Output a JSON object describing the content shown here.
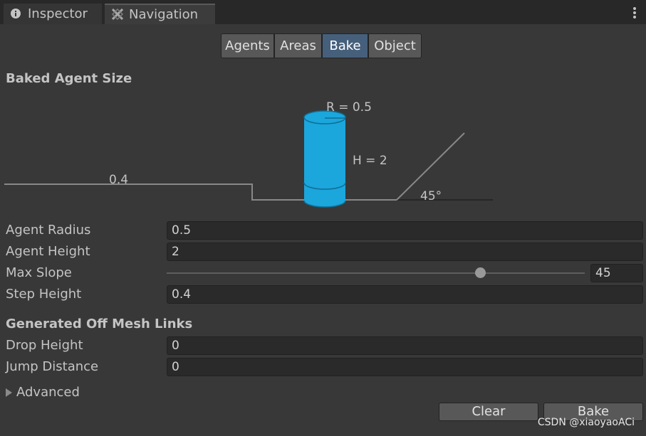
{
  "tabs": [
    {
      "label": "Inspector",
      "icon": "info-icon",
      "active": false
    },
    {
      "label": "Navigation",
      "icon": "navigation-icon",
      "active": true
    }
  ],
  "menu_icon": "kebab-menu-icon",
  "segments": [
    "Agents",
    "Areas",
    "Bake",
    "Object"
  ],
  "selected_segment": "Bake",
  "baked_agent_size": {
    "title": "Baked Agent Size",
    "radius_label": "R = 0.5",
    "height_label": "H = 2",
    "step_label": "0.4",
    "slope_label": "45°",
    "cylinder_color": "#1ba6dc"
  },
  "fields": {
    "agent_radius": {
      "label": "Agent Radius",
      "value": "0.5"
    },
    "agent_height": {
      "label": "Agent Height",
      "value": "2"
    },
    "max_slope": {
      "label": "Max Slope",
      "value": "45",
      "fraction": 0.75
    },
    "step_height": {
      "label": "Step Height",
      "value": "0.4"
    }
  },
  "off_mesh_links": {
    "title": "Generated Off Mesh Links",
    "drop_height": {
      "label": "Drop Height",
      "value": "0"
    },
    "jump_distance": {
      "label": "Jump Distance",
      "value": "0"
    }
  },
  "advanced_label": "Advanced",
  "buttons": {
    "clear": "Clear",
    "bake": "Bake"
  },
  "watermark": "CSDN @xiaoyaoACi",
  "colors": {
    "selected_segment": "#46607c",
    "panel_bg": "#383838"
  }
}
